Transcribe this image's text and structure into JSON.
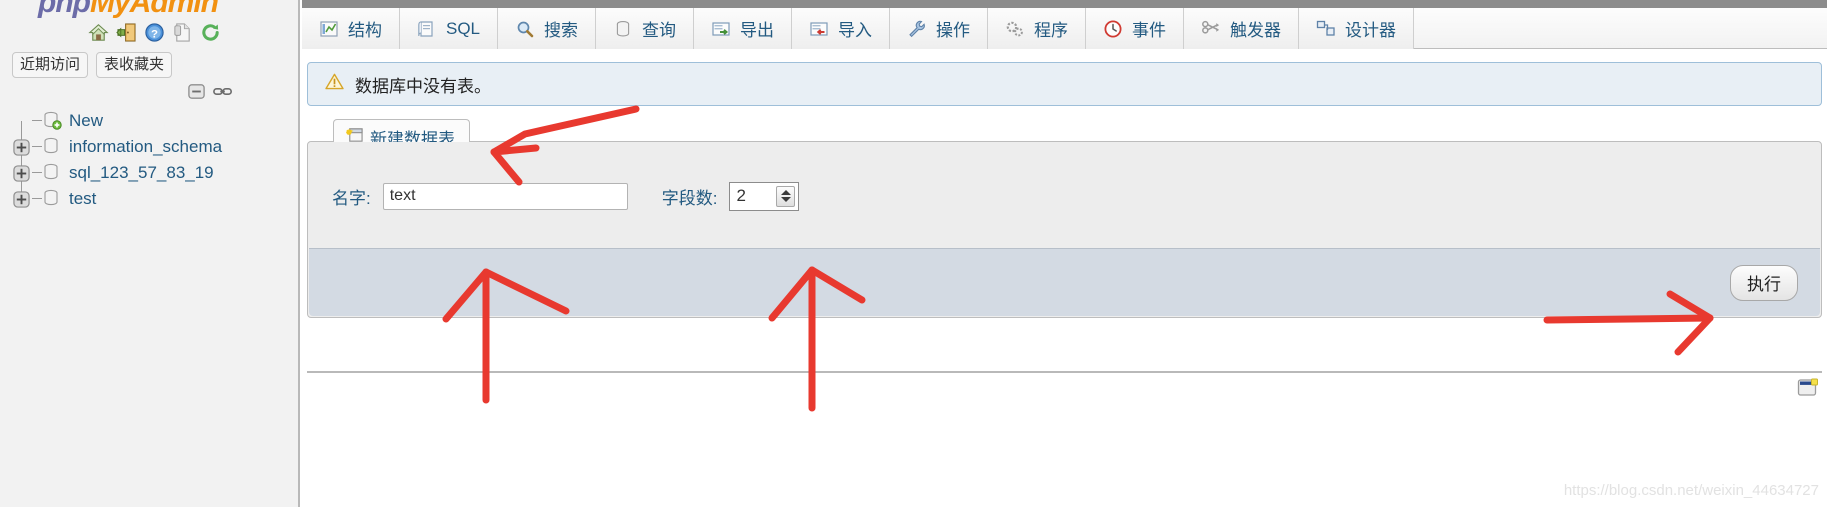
{
  "sidebar": {
    "logo": {
      "php": "php",
      "my": "My",
      "admin": "Admin"
    },
    "logo_icons": [
      {
        "name": "home-icon",
        "title": "主页"
      },
      {
        "name": "exit-icon",
        "title": "退出"
      },
      {
        "name": "help-icon",
        "title": "帮助"
      },
      {
        "name": "docs-icon",
        "title": "文档"
      },
      {
        "name": "reload-icon",
        "title": "重新加载"
      }
    ],
    "quick_buttons": [
      {
        "name": "recent-tables-button",
        "label": "近期访问"
      },
      {
        "name": "favorite-tables-button",
        "label": "表收藏夹"
      }
    ],
    "tree_tools": [
      {
        "name": "collapse-all-icon",
        "title": "全部折叠"
      },
      {
        "name": "link-with-main-icon",
        "title": "与主面板联动"
      }
    ],
    "tree": [
      {
        "label": "New",
        "expandable": false,
        "new": true
      },
      {
        "label": "information_schema",
        "expandable": true,
        "new": false
      },
      {
        "label": "sql_123_57_83_19",
        "expandable": true,
        "new": false
      },
      {
        "label": "test",
        "expandable": true,
        "new": false
      }
    ]
  },
  "tabs": [
    {
      "label": "结构",
      "icon": "structure-icon"
    },
    {
      "label": "SQL",
      "icon": "sql-icon"
    },
    {
      "label": "搜索",
      "icon": "search-icon"
    },
    {
      "label": "查询",
      "icon": "query-icon"
    },
    {
      "label": "导出",
      "icon": "export-icon"
    },
    {
      "label": "导入",
      "icon": "import-icon"
    },
    {
      "label": "操作",
      "icon": "operations-icon"
    },
    {
      "label": "程序",
      "icon": "routines-icon"
    },
    {
      "label": "事件",
      "icon": "events-icon"
    },
    {
      "label": "触发器",
      "icon": "triggers-icon"
    },
    {
      "label": "设计器",
      "icon": "designer-icon"
    }
  ],
  "notice": {
    "icon": "warning-icon",
    "text": "数据库中没有表。"
  },
  "create_table_panel": {
    "legend": "新建数据表",
    "legend_icon": "new-table-icon",
    "name_label": "名字:",
    "name_value": "text",
    "name_placeholder": "",
    "columns_label": "字段数:",
    "columns_value": "2",
    "go_label": "执行"
  },
  "console": {
    "icon": "console-icon"
  },
  "watermark": "https://blog.csdn.net/weixin_44634727",
  "colors": {
    "accent_link": "#235a81",
    "notice_bg": "#e8eff5",
    "notice_border": "#9ebfd9",
    "footer_bg": "#d3dae3",
    "panel_bg": "#ededed",
    "annotation_red": "#e8392f",
    "logo_php": "#6c6ca8",
    "logo_my": "#f29111"
  },
  "annotations": [
    {
      "name": "arrow-to-new-table-tab"
    },
    {
      "name": "arrow-to-name-field"
    },
    {
      "name": "arrow-to-columns-field"
    },
    {
      "name": "arrow-to-go-button"
    }
  ]
}
